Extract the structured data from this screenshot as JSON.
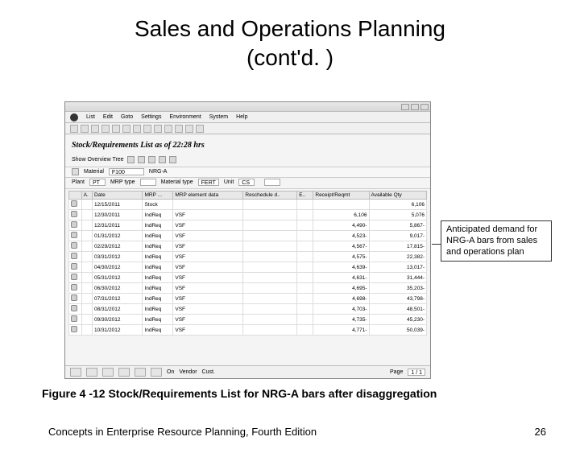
{
  "slide": {
    "title_line1": "Sales and Operations Planning",
    "title_line2": "(cont'd. )",
    "caption": "Figure 4 -12  Stock/Requirements List for NRG-A bars after disaggregation",
    "footer_left": "Concepts in Enterprise Resource Planning, Fourth Edition",
    "page_number": "26"
  },
  "callout": "Anticipated demand for NRG-A bars from sales and operations plan",
  "sap": {
    "menu_items": [
      "List",
      "Edit",
      "Goto",
      "Settings",
      "Environment",
      "System",
      "Help"
    ],
    "page_heading": "Stock/Requirements List as of 22:28 hrs",
    "subtoolbar_label": "Show Overview Tree",
    "filter1": {
      "material_label": "Material",
      "material_value": "F100",
      "product_label": "NRG-A"
    },
    "filter2": {
      "plant_label": "Plant",
      "plant_value": "PT",
      "mrp_type_label": "MRP type",
      "mrp_type_value": "",
      "material_type_label": "Material type",
      "material_type_value": "FERT",
      "unit_label": "Unit",
      "unit_value": "CS",
      "page_indicator": ""
    },
    "columns": [
      "",
      "A.",
      "Date",
      "MRP ...",
      "MRP element data",
      "Reschedule d..",
      "E..",
      "Receipt/Reqmt",
      "Available Qty"
    ],
    "rows": [
      {
        "date": "12/15/2011",
        "el": "Stock",
        "data": "",
        "req": "",
        "avail": "6,106"
      },
      {
        "date": "12/30/2011",
        "el": "IndReq",
        "data": "VSF",
        "req": "6,106",
        "avail": "5,076"
      },
      {
        "date": "12/31/2011",
        "el": "IndReq",
        "data": "VSF",
        "req": "4,490-",
        "avail": "5,867-"
      },
      {
        "date": "01/31/2012",
        "el": "IndReq",
        "data": "VSF",
        "req": "4,523-",
        "avail": "9,017-"
      },
      {
        "date": "02/29/2012",
        "el": "IndReq",
        "data": "VSF",
        "req": "4,567-",
        "avail": "17,815-"
      },
      {
        "date": "03/31/2012",
        "el": "IndReq",
        "data": "VSF",
        "req": "4,575-",
        "avail": "22,382-"
      },
      {
        "date": "04/30/2012",
        "el": "IndReq",
        "data": "VSF",
        "req": "4,639-",
        "avail": "13,017-"
      },
      {
        "date": "05/31/2012",
        "el": "IndReq",
        "data": "VSF",
        "req": "4,631-",
        "avail": "31,444-"
      },
      {
        "date": "06/30/2012",
        "el": "IndReq",
        "data": "VSF",
        "req": "4,695-",
        "avail": "35,203-"
      },
      {
        "date": "07/31/2012",
        "el": "IndReq",
        "data": "VSF",
        "req": "4,698-",
        "avail": "43,798-"
      },
      {
        "date": "08/31/2012",
        "el": "IndReq",
        "data": "VSF",
        "req": "4,703-",
        "avail": "48,501-"
      },
      {
        "date": "09/30/2012",
        "el": "IndReq",
        "data": "VSF",
        "req": "4,735-",
        "avail": "45,230-"
      },
      {
        "date": "10/31/2012",
        "el": "IndReq",
        "data": "VSF",
        "req": "4,771-",
        "avail": "50,039-"
      }
    ],
    "status": {
      "vendor": "Vendor",
      "cust": "Cust.",
      "on": "On",
      "page_label": "Page",
      "page_val": "1    /    1"
    }
  }
}
